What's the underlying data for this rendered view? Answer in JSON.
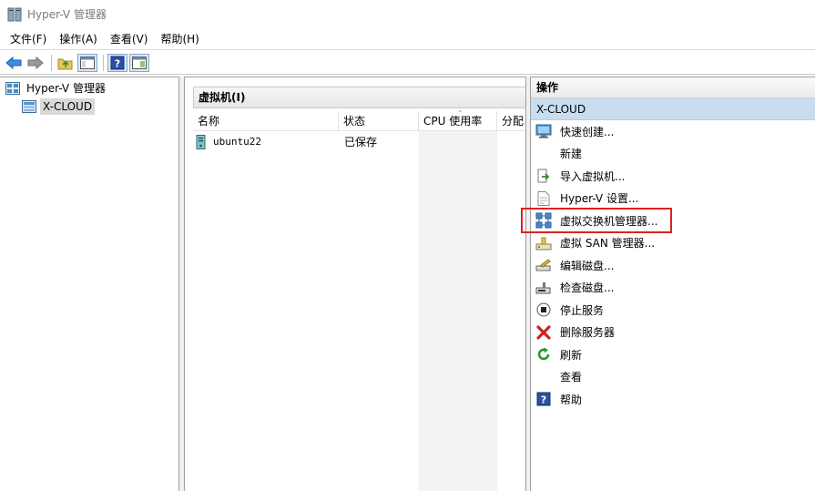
{
  "window": {
    "title": "Hyper-V 管理器"
  },
  "menubar": {
    "items": [
      "文件(F)",
      "操作(A)",
      "查看(V)",
      "帮助(H)"
    ]
  },
  "tree": {
    "root_label": "Hyper-V 管理器",
    "child_label": "X-CLOUD"
  },
  "vm_section": {
    "header": "虚拟机(I)",
    "columns": [
      "名称",
      "状态",
      "CPU 使用率",
      "分配"
    ],
    "rows": [
      {
        "name": "ubuntu22",
        "state": "已保存"
      }
    ]
  },
  "actions": {
    "title": "操作",
    "group": "X-CLOUD",
    "items": [
      {
        "label": "快速创建...",
        "icon": "monitor-icon"
      },
      {
        "label": "新建",
        "icon": ""
      },
      {
        "label": "导入虚拟机...",
        "icon": "import-icon"
      },
      {
        "label": "Hyper-V 设置...",
        "icon": "settings-doc-icon"
      },
      {
        "label": "虚拟交换机管理器...",
        "icon": "network-switch-icon"
      },
      {
        "label": "虚拟 SAN 管理器...",
        "icon": "san-icon"
      },
      {
        "label": "编辑磁盘...",
        "icon": "edit-disk-icon"
      },
      {
        "label": "检查磁盘...",
        "icon": "inspect-disk-icon"
      },
      {
        "label": "停止服务",
        "icon": "stop-icon"
      },
      {
        "label": "删除服务器",
        "icon": "delete-icon"
      },
      {
        "label": "刷新",
        "icon": "refresh-icon"
      },
      {
        "label": "查看",
        "icon": ""
      },
      {
        "label": "帮助",
        "icon": "help-icon"
      }
    ]
  },
  "colors": {
    "group_bg": "#c9ddf0",
    "highlight": "#e02020",
    "accent": "#1e72c8"
  }
}
